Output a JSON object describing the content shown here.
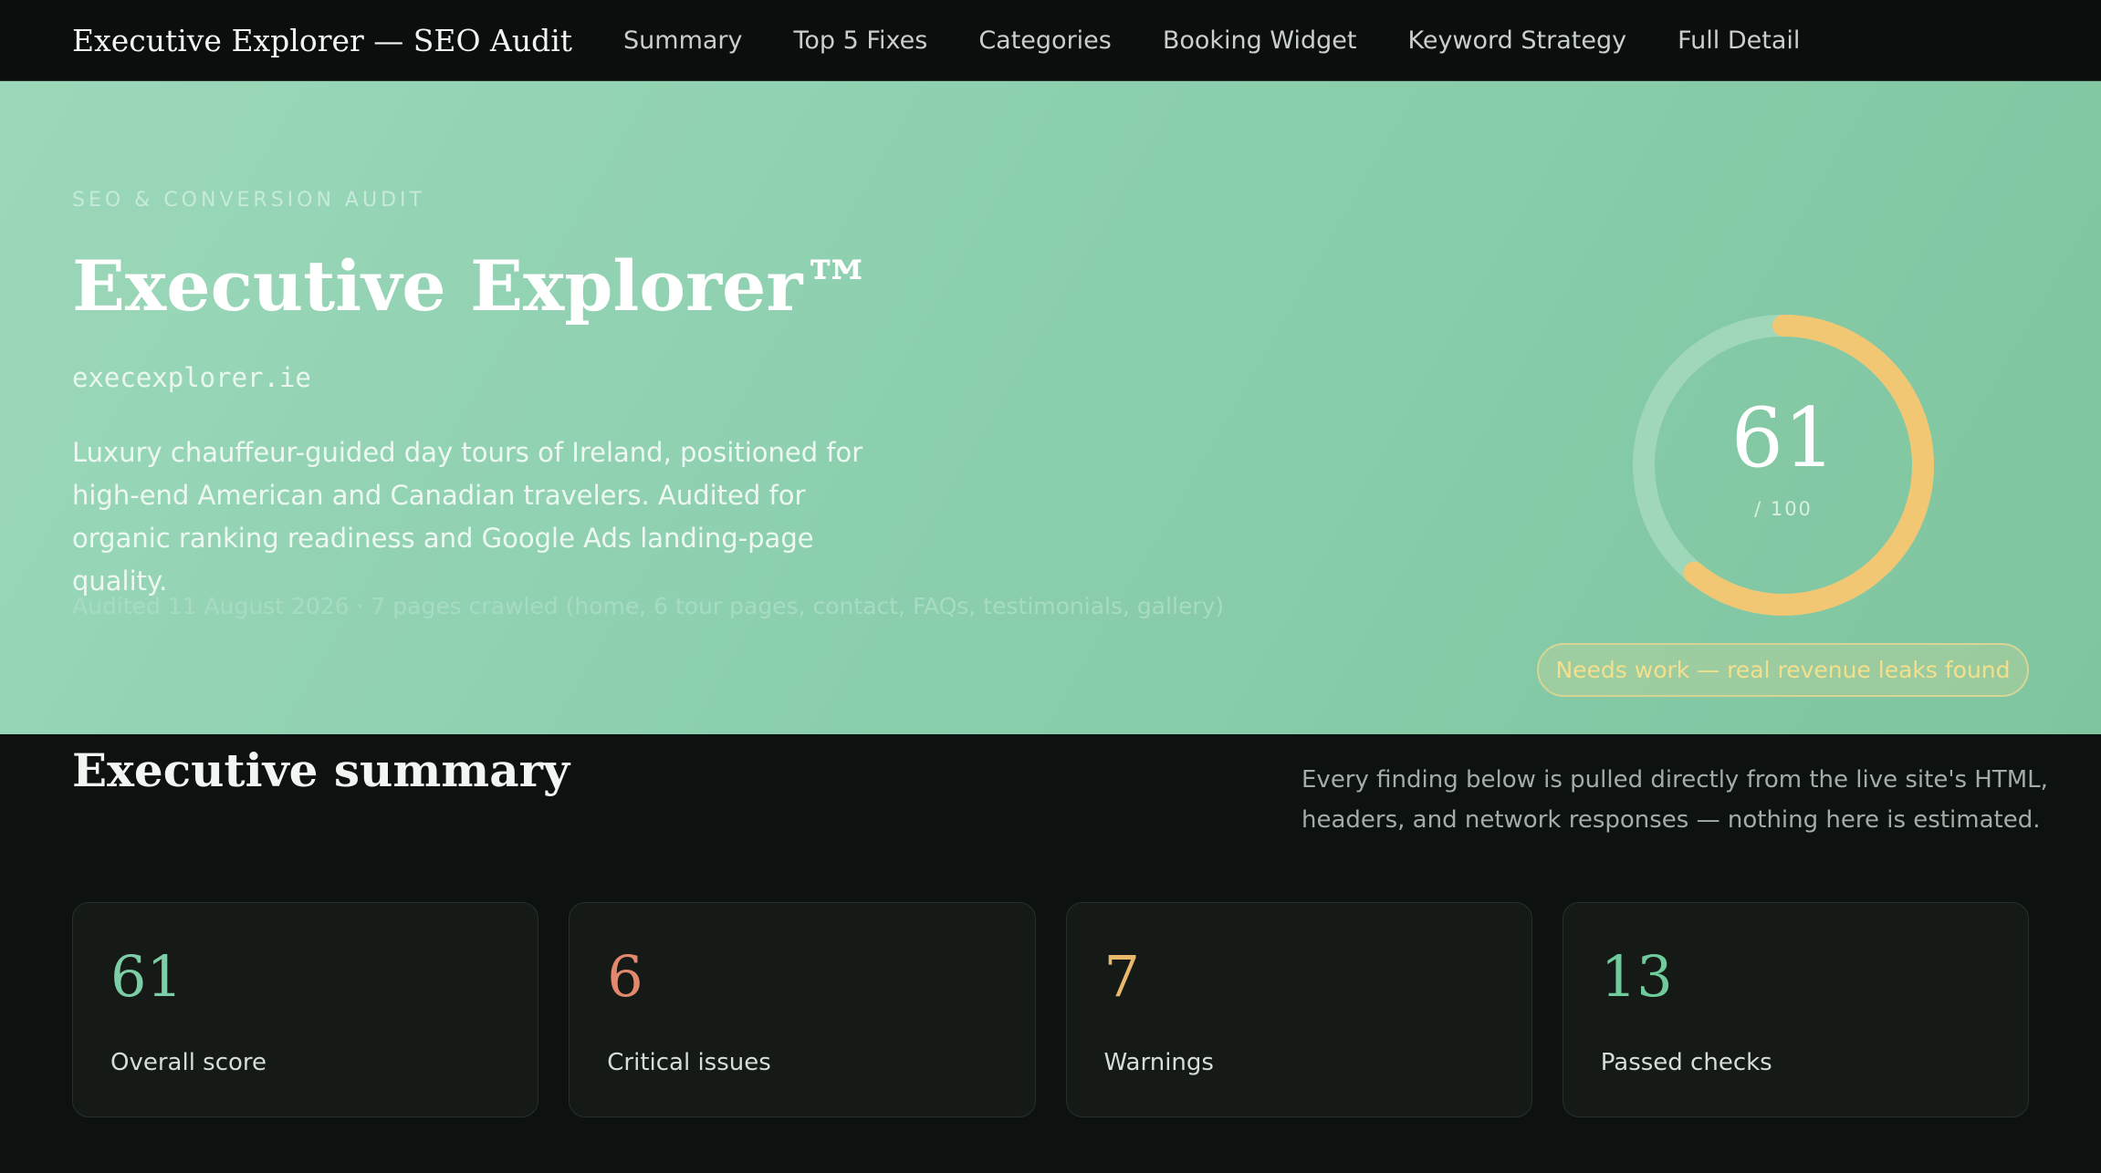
{
  "nav": {
    "brand": "Executive Explorer — SEO Audit",
    "links": [
      "Summary",
      "Top 5 Fixes",
      "Categories",
      "Booking Widget",
      "Keyword Strategy",
      "Full Detail"
    ]
  },
  "hero": {
    "eyebrow": "SEO & CONVERSION AUDIT",
    "title": "Executive Explorer™",
    "domain": "execexplorer.ie",
    "description": "Luxury chauffeur-guided day tours of Ireland, positioned for high-end American and Canadian travelers. Audited for organic ranking readiness and Google Ads landing-page quality.",
    "audited": "Audited 11 August 2026 · 7 pages crawled (home, 6 tour pages, contact, FAQs, testimonials, gallery)",
    "score": {
      "value": 61,
      "max_label": "/ 100",
      "fraction": 0.61,
      "arc_color": "#f2c774",
      "track_color": "#b6e2cb"
    },
    "verdict": "Needs work — real revenue leaks found"
  },
  "summary": {
    "title": "Executive summary",
    "note": "Every finding below is pulled directly from the live site's HTML, headers, and network responses — nothing here is estimated.",
    "cards": [
      {
        "value": "61",
        "label": "Overall score",
        "color": "#7dcea6"
      },
      {
        "value": "6",
        "label": "Critical issues",
        "color": "#e2896d"
      },
      {
        "value": "7",
        "label": "Warnings",
        "color": "#e9b86a"
      },
      {
        "value": "13",
        "label": "Passed checks",
        "color": "#6fcb9c"
      }
    ]
  }
}
